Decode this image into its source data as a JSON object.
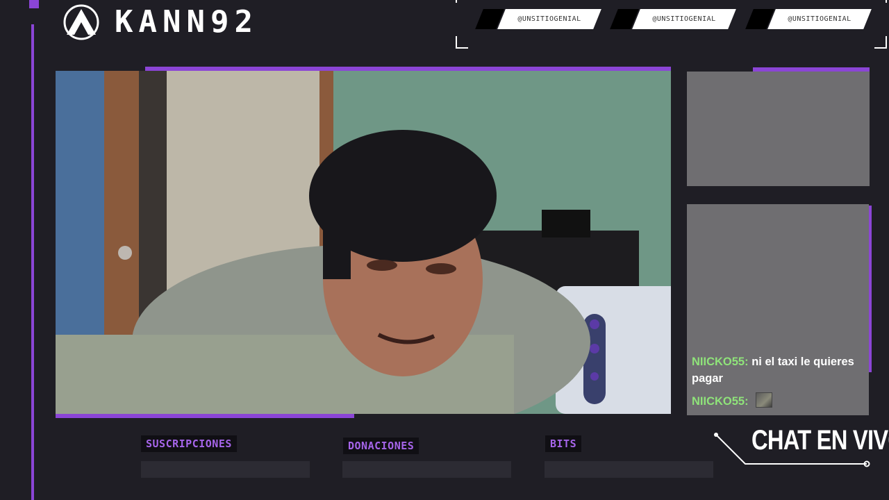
{
  "brand": {
    "name": "KANN92"
  },
  "socials": [
    "@UNSITIOGENIAL",
    "@UNSITIOGENIAL",
    "@UNSITIOGENIAL"
  ],
  "chat": {
    "title": "CHAT EN VIVO",
    "messages": [
      {
        "user": "NIICKO55",
        "text": "ni el taxi le quieres pagar",
        "emote": false
      },
      {
        "user": "NIICKO55",
        "text": "",
        "emote": true
      }
    ]
  },
  "stats": {
    "subs_label": "SUSCRIPCIONES",
    "donations_label": "DONACIONES",
    "bits_label": "BITS"
  },
  "colors": {
    "accent": "#8b45d6",
    "background": "#1f1e25",
    "chat_user": "#8fe37a"
  }
}
